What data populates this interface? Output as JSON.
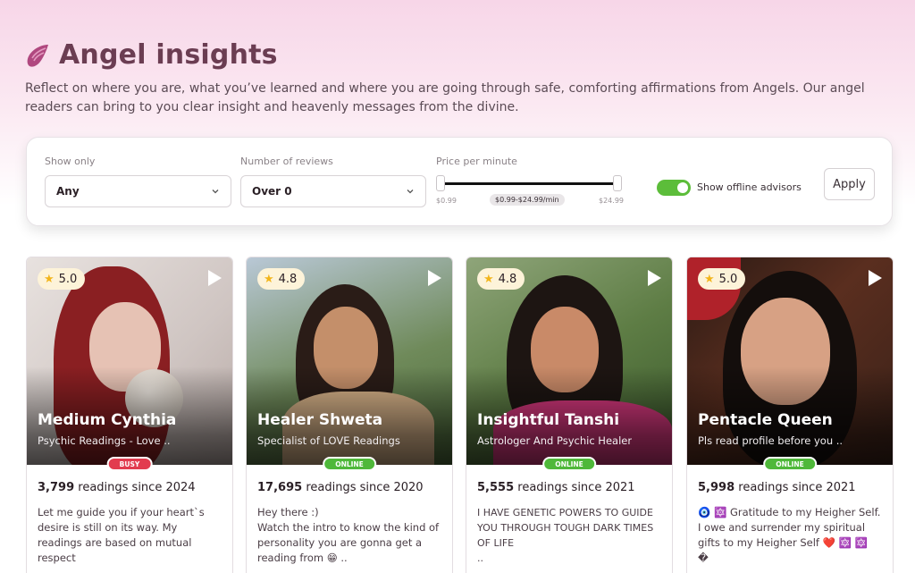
{
  "header": {
    "title": "Angel insights",
    "description": "Reflect on where you are, what you’ve learned and where you are going through safe, comforting affirmations from Angels. Our angel readers can bring to you clear insight and heavenly messages from the divine."
  },
  "filters": {
    "show_only_label": "Show only",
    "show_only_value": "Any",
    "reviews_label": "Number of reviews",
    "reviews_value": "Over 0",
    "price_label": "Price per minute",
    "price_min": "$0.99",
    "price_max": "$24.99",
    "price_range": "$0.99-$24.99/min",
    "offline_toggle_label": "Show offline advisors",
    "offline_toggle_on": true,
    "apply_label": "Apply"
  },
  "colors": {
    "accent": "#6b3d52",
    "online": "#4fb83a",
    "busy": "#e23c4f",
    "toggle": "#5cbd3a",
    "star": "#f2b51b"
  },
  "advisors": [
    {
      "rating": "5.0",
      "name": "Medium Cynthia",
      "specialty": "Psychic Readings - Love ..",
      "status": "BUSY",
      "readings_count": "3,799",
      "readings_text": "readings since 2024",
      "bio": "Let me guide you if your heart`s desire is still on its way. My readings are based on mutual respect"
    },
    {
      "rating": "4.8",
      "name": "Healer Shweta",
      "specialty": "Specialist of LOVE Readings",
      "status": "ONLINE",
      "readings_count": "17,695",
      "readings_text": "readings since 2020",
      "bio": "Hey there :)\nWatch the intro to know the kind of personality you are gonna get a reading from 😁 .."
    },
    {
      "rating": "4.8",
      "name": "Insightful Tanshi",
      "specialty": "Astrologer And Psychic Healer",
      "status": "ONLINE",
      "readings_count": "5,555",
      "readings_text": "readings since 2021",
      "bio": "I HAVE GENETIC POWERS TO GUIDE YOU THROUGH TOUGH DARK TIMES OF LIFE\n.."
    },
    {
      "rating": "5.0",
      "name": "Pentacle Queen",
      "specialty": "Pls read profile before you ..",
      "status": "ONLINE",
      "readings_count": "5,998",
      "readings_text": "readings since 2021",
      "bio": "🧿 🔯 Gratitude to my Heigher Self. I owe and surrender my spiritual gifts to my Heigher Self ❤️ 🔯 🔯 �"
    }
  ]
}
